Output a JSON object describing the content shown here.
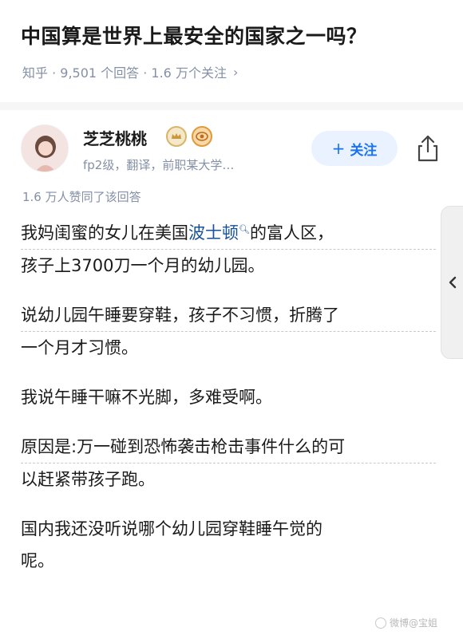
{
  "question": {
    "title": "中国算是世界上最安全的国家之一吗？",
    "meta": "知乎 · 9,501 个回答 · 1.6 万个关注",
    "chevron": "›"
  },
  "author": {
    "name": "芝芝桃桃",
    "description": "fp2级，翻译，前职某大学…",
    "follow_plus": "+",
    "follow_label": "关注"
  },
  "answer": {
    "upvote_text": "1.6 万人赞同了该回答",
    "p1_line1_prefix": "我妈闺蜜的女儿在美国",
    "p1_line1_link": "波士顿",
    "p1_line1_suffix": "的富人区，",
    "p1_line2": "孩子上3700刀一个月的幼儿园。",
    "p2_line1": "说幼儿园午睡要穿鞋，孩子不习惯，折腾了",
    "p2_line2": "一个月才习惯。",
    "p3_line1": "我说午睡干嘛不光脚，多难受啊。",
    "p4_line1": "原因是:万一碰到恐怖袭击枪击事件什么的可",
    "p4_line2": "以赶紧带孩子跑。",
    "p5_line1": "国内我还没听说哪个幼儿园穿鞋睡午觉的",
    "p5_line2": "呢。"
  },
  "watermark": "微博@宝姐",
  "colors": {
    "accent_blue": "#1772f6",
    "follow_bg": "#eaf2ff",
    "meta_gray": "#8590a6",
    "link_blue": "#175199"
  },
  "icons": {
    "share": "share-icon",
    "search_small": "search-icon",
    "collapse": "chevron-left-icon"
  }
}
